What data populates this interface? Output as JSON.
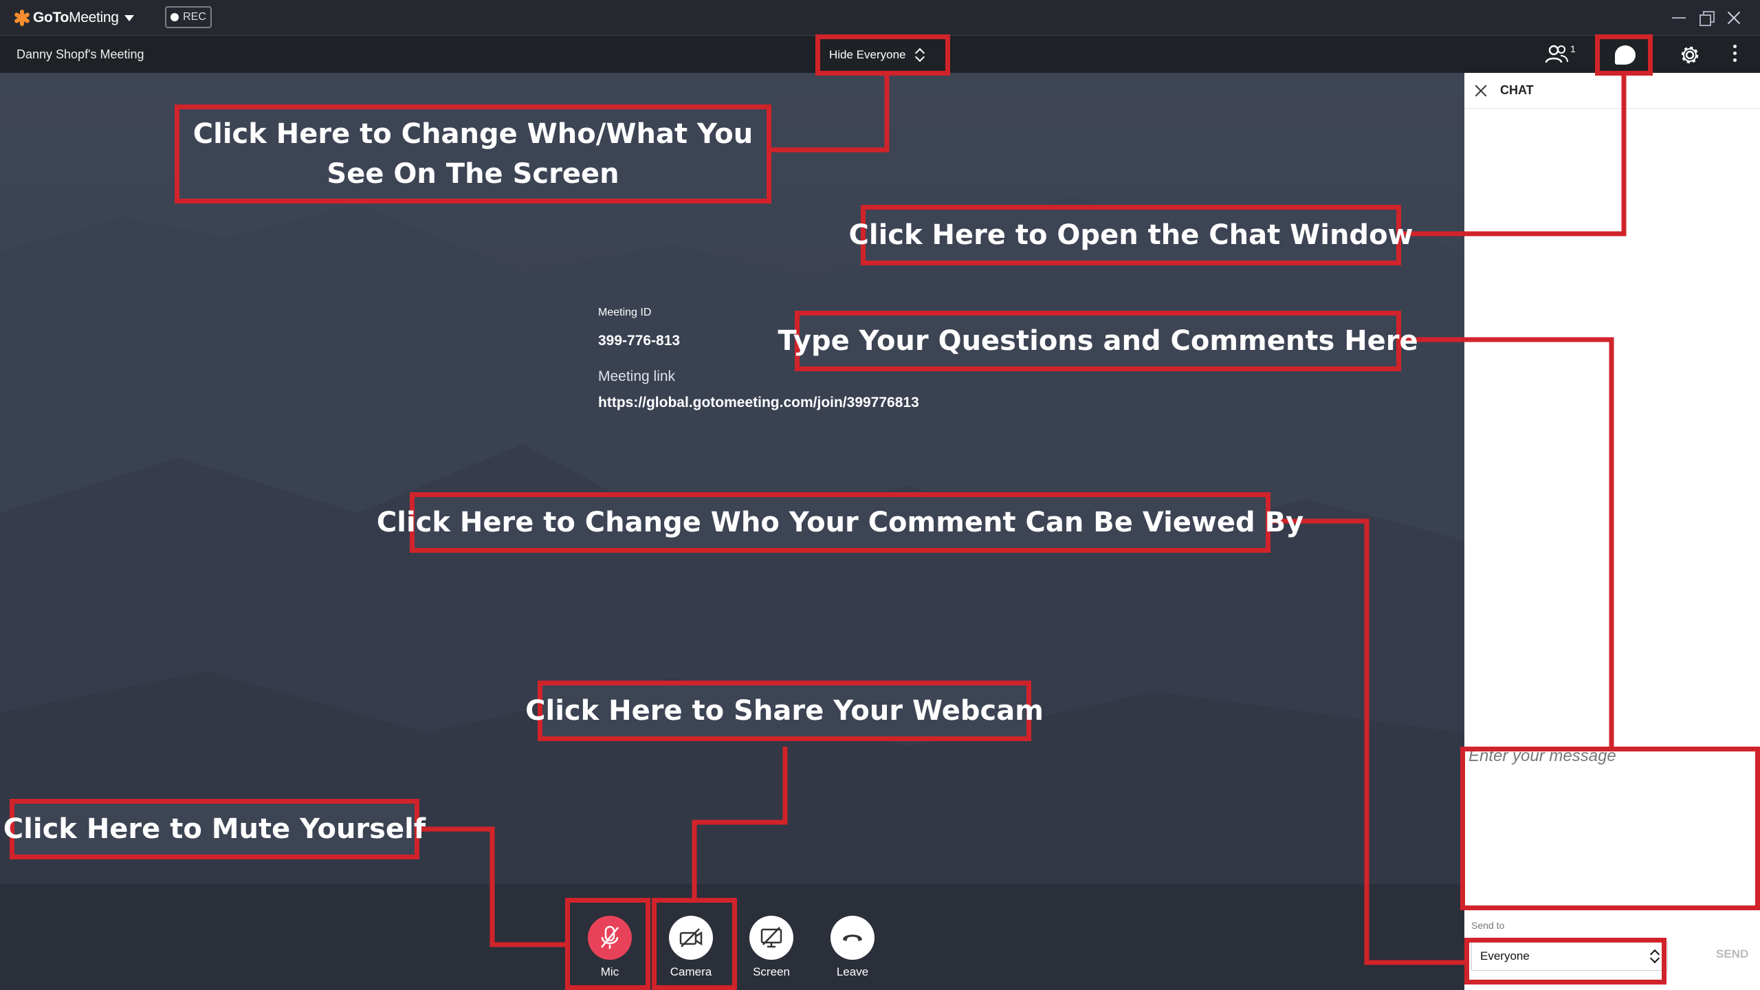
{
  "app": {
    "logo_brand": "GoTo",
    "logo_product": "Meeting",
    "rec_label": "REC",
    "meeting_title": "Danny Shopf's Meeting"
  },
  "toolbar": {
    "view_selector": "Hide Everyone",
    "participants_count": "1"
  },
  "meeting_info": {
    "id_label": "Meeting ID",
    "id_value": "399-776-813",
    "link_label": "Meeting link",
    "link_value": "https://global.gotomeeting.com/join/399776813"
  },
  "controls": [
    {
      "label": "Mic",
      "state": "muted"
    },
    {
      "label": "Camera",
      "state": "off"
    },
    {
      "label": "Screen",
      "state": "off"
    },
    {
      "label": "Leave"
    }
  ],
  "chat": {
    "title": "CHAT",
    "message_placeholder": "Enter your message",
    "send_to_label": "Send to",
    "send_to_value": "Everyone",
    "send_label": "SEND"
  },
  "annotations": {
    "view": "Click Here to Change Who/What You See On The Screen",
    "chat": "Click Here to Open the Chat Window",
    "type": "Type Your Questions and Comments Here",
    "recipient": "Click Here to Change Who Your Comment Can Be Viewed By",
    "webcam": "Click Here to Share Your Webcam",
    "mute": "Click Here to Mute Yourself"
  },
  "colors": {
    "annotation": "#d1232a",
    "mic_muted": "#e8425a",
    "logo": "#f68d2e"
  }
}
